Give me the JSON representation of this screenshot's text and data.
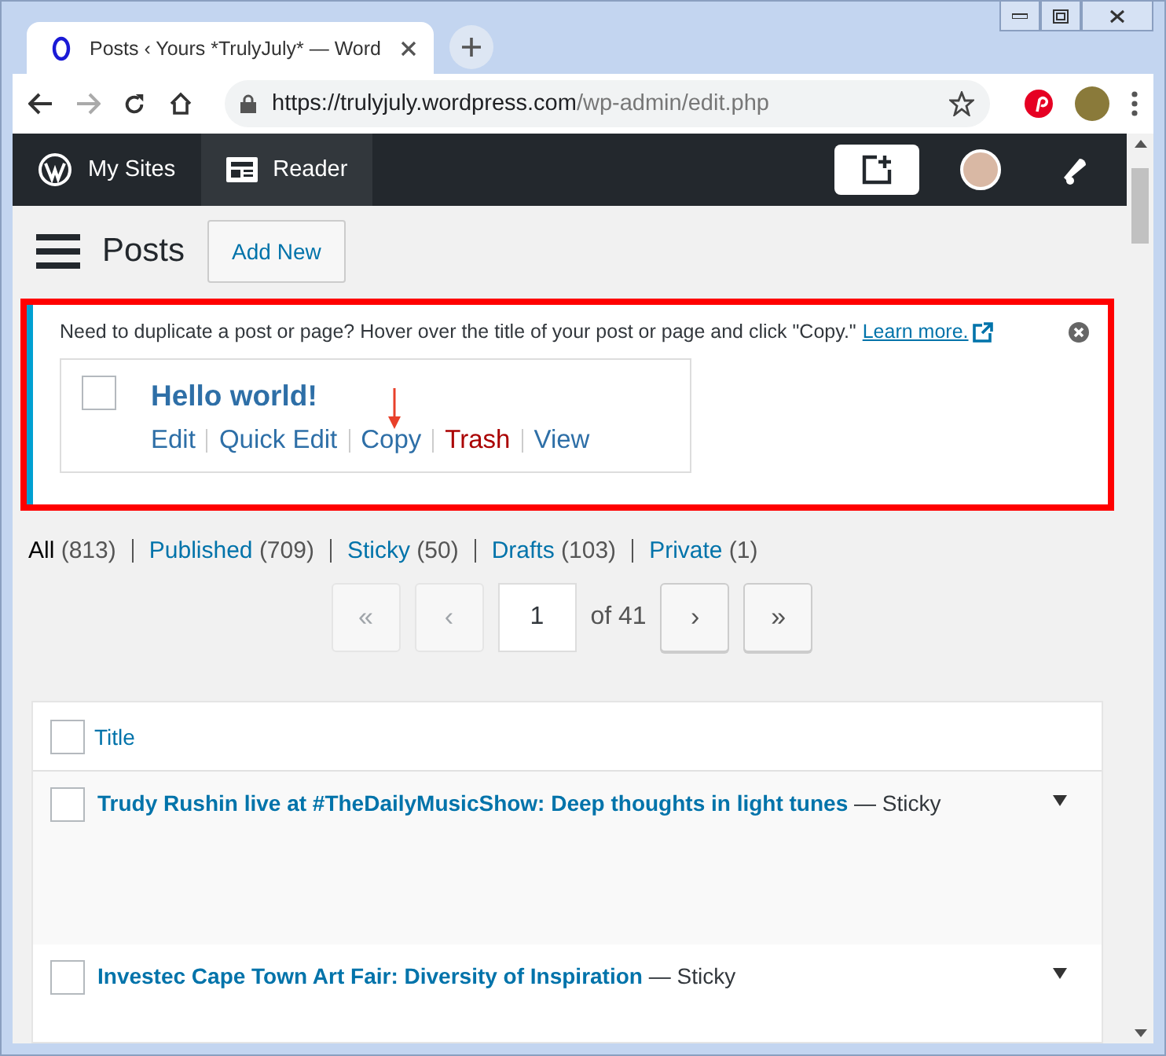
{
  "browser": {
    "tab_title": "Posts ‹ Yours *TrulyJuly* — Word",
    "url_host": "https://trulyjuly.wordpress.com",
    "url_path": "/wp-admin/edit.php"
  },
  "masterbar": {
    "items": [
      {
        "label": "My Sites",
        "selected": false
      },
      {
        "label": "Reader",
        "selected": true
      }
    ]
  },
  "page": {
    "title": "Posts",
    "add_new": "Add New"
  },
  "notice": {
    "text": "Need to duplicate a post or page? Hover over the title of your post or page and click \"Copy.\"",
    "link": "Learn more.",
    "example": {
      "title": "Hello world!",
      "checked": false,
      "actions": [
        {
          "label": "Edit",
          "kind": "normal"
        },
        {
          "label": "Quick Edit",
          "kind": "normal"
        },
        {
          "label": "Copy",
          "kind": "normal"
        },
        {
          "label": "Trash",
          "kind": "danger"
        },
        {
          "label": "View",
          "kind": "normal"
        }
      ]
    }
  },
  "filters": [
    {
      "label": "All",
      "count": "(813)",
      "selected": true
    },
    {
      "label": "Published",
      "count": "(709)",
      "selected": false
    },
    {
      "label": "Sticky",
      "count": "(50)",
      "selected": false
    },
    {
      "label": "Drafts",
      "count": "(103)",
      "selected": false
    },
    {
      "label": "Private",
      "count": "(1)",
      "selected": false
    }
  ],
  "pagination": {
    "first": {
      "label": "«",
      "disabled": true
    },
    "prev": {
      "label": "‹",
      "disabled": true
    },
    "page": "1",
    "of": "of 41",
    "next": {
      "label": "›",
      "disabled": false
    },
    "last": {
      "label": "»",
      "disabled": false
    }
  },
  "table": {
    "column": "Title",
    "select_all_checked": false,
    "rows": [
      {
        "title": "Trudy Rushin live at #TheDailyMusicShow: Deep thoughts in light tunes",
        "state": "— Sticky",
        "checked": false
      },
      {
        "title": "Investec Cape Town Art Fair: Diversity of Inspiration",
        "state": "— Sticky",
        "checked": false
      }
    ]
  }
}
